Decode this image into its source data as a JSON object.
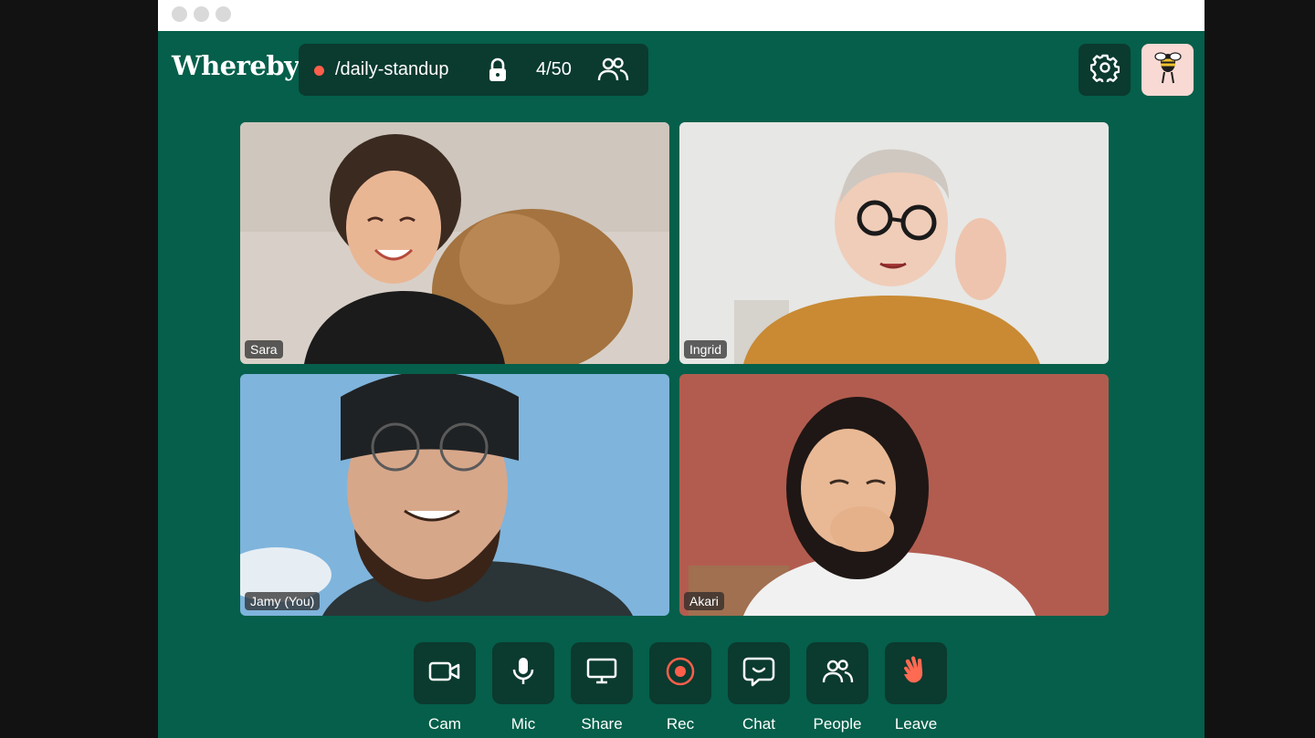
{
  "app": {
    "logo_text": "Whereby"
  },
  "room": {
    "name": "/daily-standup",
    "participant_count": "4/50",
    "status_color": "#ff5f4a",
    "locked": true
  },
  "participants": [
    {
      "name": "Sara"
    },
    {
      "name": "Ingrid"
    },
    {
      "name": "Jamy (You)"
    },
    {
      "name": "Akari"
    }
  ],
  "controls": {
    "cam": "Cam",
    "mic": "Mic",
    "share": "Share",
    "rec": "Rec",
    "chat": "Chat",
    "people": "People",
    "leave": "Leave"
  },
  "icons": {
    "settings": "gear-icon",
    "avatar": "bee-avatar-icon",
    "lock": "lock-icon",
    "people": "people-icon",
    "cam": "camera-icon",
    "mic": "microphone-icon",
    "share": "monitor-icon",
    "rec": "record-icon",
    "chat": "chat-icon",
    "leave": "wave-hand-icon"
  },
  "colors": {
    "background": "#055f4a",
    "panel": "#0b3a2f",
    "accent": "#ff5f4a",
    "avatar_bg": "#f8d9d3"
  }
}
